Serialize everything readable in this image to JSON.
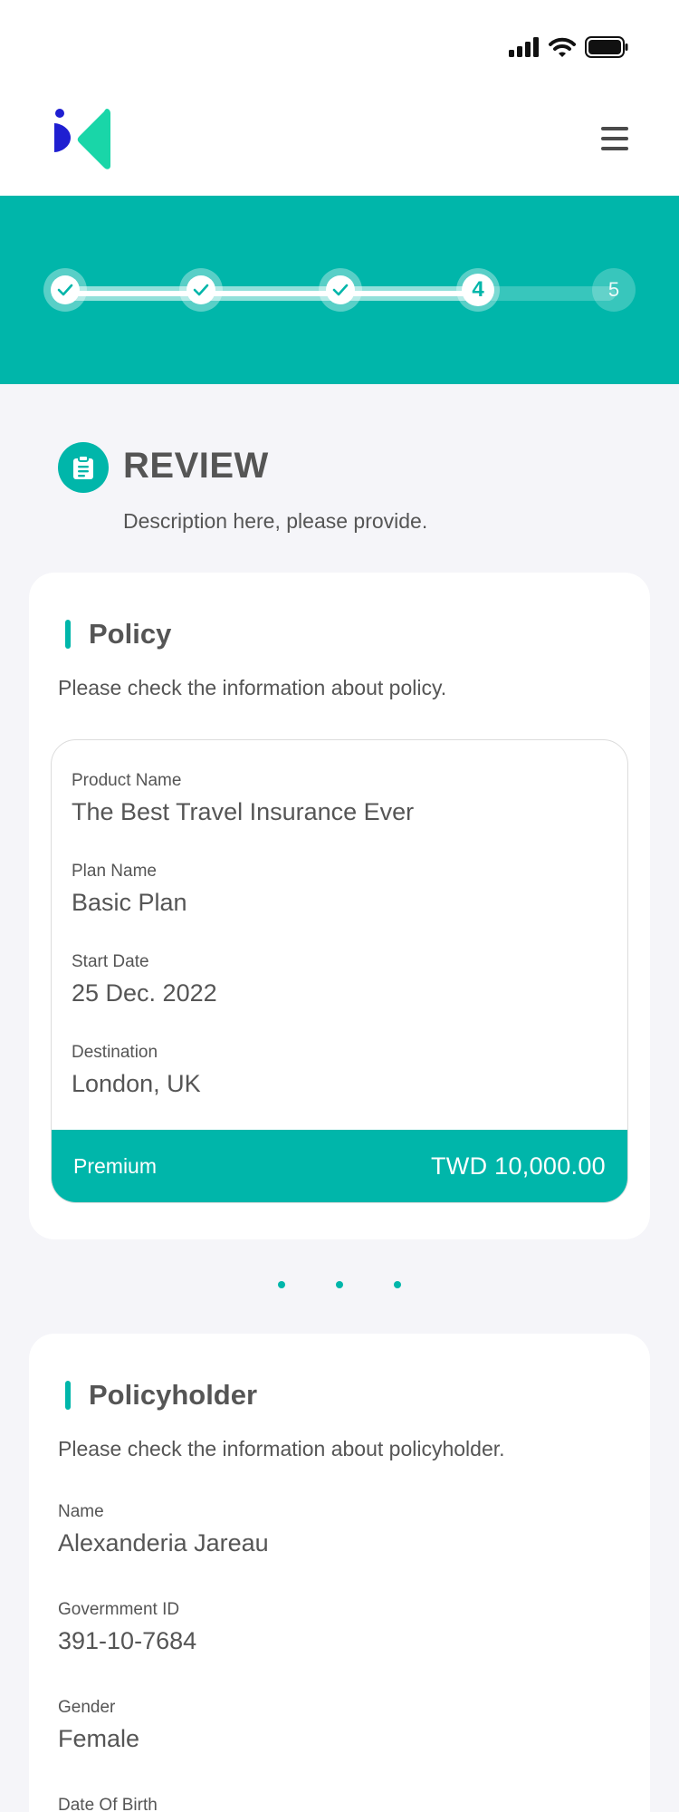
{
  "review": {
    "title": "REVIEW",
    "description": "Description here, please provide."
  },
  "stepper": {
    "steps": [
      {
        "state": "done",
        "label": ""
      },
      {
        "state": "done",
        "label": ""
      },
      {
        "state": "done",
        "label": ""
      },
      {
        "state": "current",
        "label": "4"
      },
      {
        "state": "pending",
        "label": "5"
      }
    ]
  },
  "policy": {
    "title": "Policy",
    "description": "Please check the information about policy.",
    "fields": [
      {
        "label": "Product Name",
        "value": "The Best Travel Insurance Ever"
      },
      {
        "label": "Plan Name",
        "value": "Basic Plan"
      },
      {
        "label": "Start Date",
        "value": "25 Dec. 2022"
      },
      {
        "label": "Destination",
        "value": "London, UK"
      }
    ],
    "premium_label": "Premium",
    "premium_amount": "TWD  10,000.00"
  },
  "policyholder": {
    "title": "Policyholder",
    "description": "Please check the information about policyholder.",
    "fields": [
      {
        "label": "Name",
        "value": "Alexanderia Jareau"
      },
      {
        "label": "Govermment  ID",
        "value": "391-10-7684"
      },
      {
        "label": "Gender",
        "value": "Female"
      },
      {
        "label": "Date Of Birth",
        "value": ""
      }
    ]
  },
  "colors": {
    "accent": "#00b6aa",
    "text": "#555555",
    "logo_blue": "#1f1fd1",
    "logo_green": "#19d6a8"
  },
  "icons": {
    "signal": "cellular-signal-icon",
    "wifi": "wifi-icon",
    "battery": "battery-icon",
    "menu": "hamburger-menu-icon",
    "review": "clipboard-icon",
    "check": "check-icon"
  }
}
